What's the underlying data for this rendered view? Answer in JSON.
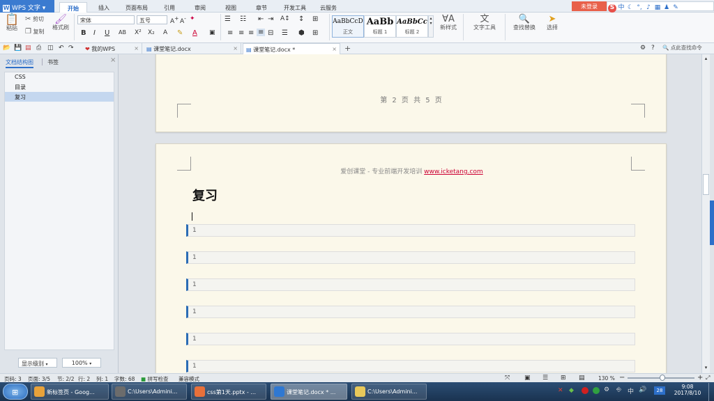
{
  "app": {
    "name": "WPS 文字",
    "logo": "W"
  },
  "ribbon_tabs": [
    "开始",
    "插入",
    "页面布局",
    "引用",
    "审阅",
    "视图",
    "章节",
    "开发工具",
    "云服务"
  ],
  "active_tab": "开始",
  "login_label": "未登录",
  "clipboard": {
    "paste": "粘贴",
    "cut": "剪切",
    "copy": "复制",
    "format_painter": "格式刷"
  },
  "font": {
    "name": "宋体",
    "size": "五号"
  },
  "styles": [
    {
      "sample": "AaBbCcD",
      "label": "正文"
    },
    {
      "sample": "AaBb",
      "label": "标题 1"
    },
    {
      "sample": "AaBbCc",
      "label": "标题 2"
    }
  ],
  "ribbon_right": {
    "new_style": "新样式",
    "text_tools": "文字工具",
    "find_replace": "查找替换",
    "select": "选择"
  },
  "doc_tabs": [
    {
      "label": "我的WPS",
      "active": false
    },
    {
      "label": "课堂笔记.docx",
      "active": false
    },
    {
      "label": "课堂笔记.docx *",
      "active": true
    }
  ],
  "search_placeholder": "点此查找命令",
  "nav": {
    "tabs": [
      "文档结构图",
      "书签"
    ],
    "active_tab": "文档结构图",
    "items": [
      "CSS",
      "目录",
      "复习"
    ],
    "selected_item": "复习",
    "level_label": "显示级别",
    "zoom_value": "100%"
  },
  "document": {
    "page_footer": "第 2 页 共 5 页",
    "page_header_prefix": "爱创课堂 - 专业前端开发培训 ",
    "page_header_url": "www.icketang.com",
    "heading": "复习",
    "code_lines": [
      "1",
      "1",
      "1",
      "1",
      "1",
      "1"
    ]
  },
  "status": {
    "page_no": "页码: 3",
    "page_count": "页面: 3/5",
    "section": "节: 2/2",
    "row": "行: 2",
    "col": "列: 1",
    "words": "字数: 68",
    "spell": "拼写检查",
    "compat": "兼容模式",
    "zoom": "130 %"
  },
  "taskbar": {
    "items": [
      {
        "label": "新标签页 - Goog...",
        "color": "#e8a23a"
      },
      {
        "label": "C:\\Users\\Admini...",
        "color": "#6c6c6c"
      },
      {
        "label": "css第1天.pptx - ...",
        "color": "#e8703a"
      },
      {
        "label": "课堂笔记.docx * ...",
        "color": "#2f78d2"
      },
      {
        "label": "C:\\Users\\Admini...",
        "color": "#e8c85a"
      }
    ],
    "active_index": 3,
    "time": "9:08",
    "date": "2017/8/10",
    "tray_badge": "28"
  },
  "colors": {
    "accent": "#2d6fc9",
    "page": "#fbf8ea",
    "code_border": "#2b6cb5",
    "login": "#e8604a"
  }
}
